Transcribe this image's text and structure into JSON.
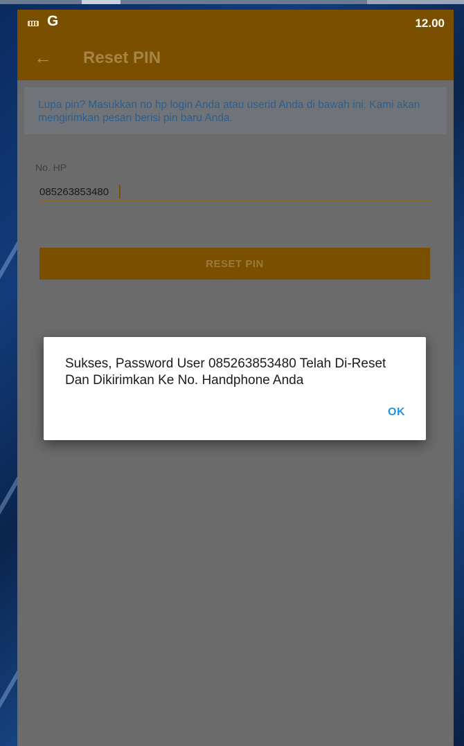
{
  "status_bar": {
    "carrier_glyph": "G",
    "time": "12.00"
  },
  "app_bar": {
    "back_glyph": "←",
    "title": "Reset PIN"
  },
  "info_banner": {
    "text": "Lupa pin? Masukkan no hp login Anda atau userid Anda di bawah ini. Kami akan mengirimkan pesan berisi pin baru Anda."
  },
  "form": {
    "phone_label": "No. HP",
    "phone_value": "085263853480",
    "reset_button_label": "RESET PIN"
  },
  "dialog": {
    "message": "Sukses, Password User 085263853480 Telah Di-Reset Dan Dikirimkan Ke No. Handphone Anda",
    "ok_label": "OK"
  },
  "colors": {
    "app_bar": "#7a4f00",
    "dialog_ok": "#1e96e6",
    "scrim_background": "#6b6b6b"
  }
}
